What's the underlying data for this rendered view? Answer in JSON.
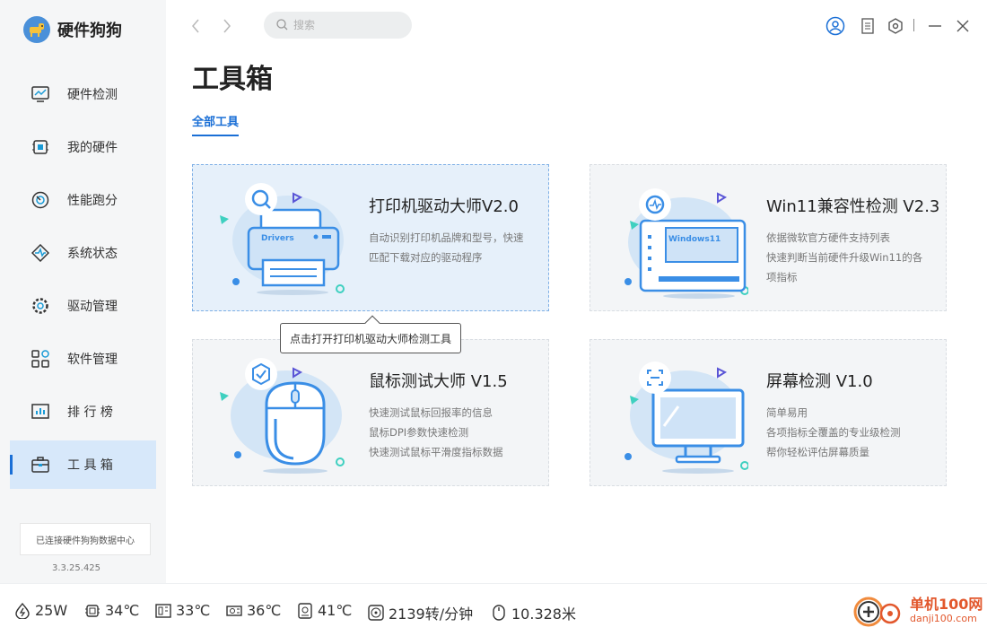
{
  "app": {
    "name": "硬件狗狗",
    "version": "3.3.25.425",
    "connection_status": "已连接硬件狗狗数据中心"
  },
  "sidebar": {
    "items": [
      {
        "label": "硬件检测",
        "icon": "monitor-chart-icon"
      },
      {
        "label": "我的硬件",
        "icon": "chip-icon"
      },
      {
        "label": "性能跑分",
        "icon": "speedometer-icon"
      },
      {
        "label": "系统状态",
        "icon": "pulse-icon"
      },
      {
        "label": "驱动管理",
        "icon": "gear-icon"
      },
      {
        "label": "软件管理",
        "icon": "apps-grid-icon"
      },
      {
        "label": "排 行 榜",
        "icon": "ranking-icon"
      },
      {
        "label": "工 具 箱",
        "icon": "toolbox-icon",
        "active": true
      }
    ]
  },
  "topbar": {
    "search_placeholder": "搜索",
    "icons": [
      "back-arrow-icon",
      "forward-arrow-icon",
      "user-icon",
      "notes-icon",
      "settings-icon",
      "minimize-icon",
      "close-icon"
    ]
  },
  "page": {
    "title": "工具箱",
    "tab": "全部工具"
  },
  "tools": [
    {
      "title": "打印机驱动大师V2.0",
      "desc": [
        "自动识别打印机品牌和型号，快速",
        "匹配下载对应的驱动程序"
      ],
      "art_label": "Drivers",
      "hover": true
    },
    {
      "title": "Win11兼容性检测 V2.3",
      "desc": [
        "依据微软官方硬件支持列表",
        "快速判断当前硬件升级Win11的各",
        "项指标"
      ],
      "art_label": "Windows11"
    },
    {
      "title": "鼠标测试大师 V1.5",
      "desc": [
        "快速测试鼠标回报率的信息",
        "鼠标DPI参数快速检测",
        "快速测试鼠标平滑度指标数据"
      ]
    },
    {
      "title": "屏幕检测 V1.0",
      "desc": [
        "简单易用",
        "各项指标全覆盖的专业级检测",
        "帮你轻松评估屏幕质量"
      ]
    }
  ],
  "tooltip": "点击打开打印机驱动大师检测工具",
  "status_bar": [
    {
      "icon": "power-icon",
      "value": "25W"
    },
    {
      "icon": "cpu-icon",
      "value": "34℃"
    },
    {
      "icon": "motherboard-icon",
      "value": "33℃"
    },
    {
      "icon": "gpu-icon",
      "value": "36℃"
    },
    {
      "icon": "disk-icon",
      "value": "41℃"
    },
    {
      "icon": "fan-icon",
      "value": "2139转/分钟"
    },
    {
      "icon": "mouse-icon",
      "value": "10.328米"
    }
  ],
  "watermark": {
    "line1": "单机100网",
    "line2": "danji100.com"
  },
  "colors": {
    "accent": "#1a6fd6",
    "sidebar_active": "#d7e8fa",
    "card_bg": "#f3f5f7",
    "card_hover": "#e6f0fa",
    "illustration": "#3a8ee6"
  }
}
